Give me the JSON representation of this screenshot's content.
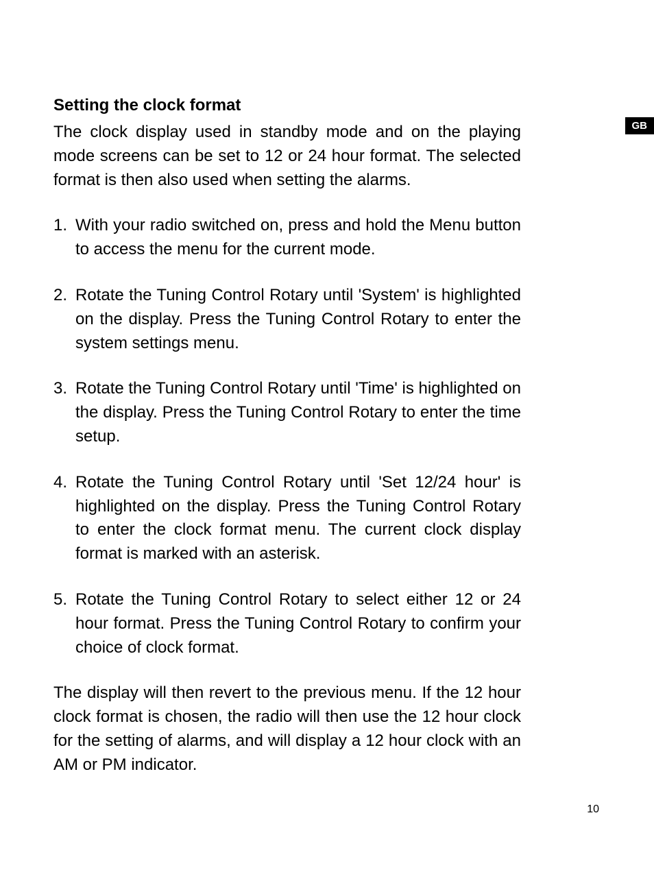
{
  "badge": "GB",
  "pageNumber": "10",
  "sectionTitle": "Setting the clock format",
  "introText": "The clock display used in standby mode and on the playing mode screens can be set to 12 or 24 hour format. The selected format is then also used when setting the alarms.",
  "steps": [
    {
      "number": "1.",
      "text": "With your radio switched on, press and hold the Menu button to access the menu for the current mode."
    },
    {
      "number": "2.",
      "text": "Rotate the Tuning Control Rotary until 'System' is highlighted on the display. Press the Tuning Control Rotary to enter the system settings menu."
    },
    {
      "number": "3.",
      "text": "Rotate the Tuning Control Rotary until 'Time' is highlighted on the display. Press the Tuning Control Rotary to enter the time setup."
    },
    {
      "number": "4.",
      "text": "Rotate the Tuning Control Rotary until 'Set 12/24 hour' is highlighted on the display. Press the Tuning Control Rotary to enter the clock format menu. The current clock display format is marked with an asterisk."
    },
    {
      "number": "5.",
      "text": "Rotate the Tuning Control Rotary to select either 12 or 24 hour format. Press the Tuning Control Rotary to confirm your choice of clock format."
    }
  ],
  "closingText": "The display will then revert to the previous menu. If the 12 hour clock format is chosen, the radio will then use the 12 hour clock for the setting of alarms, and will display a 12 hour clock with an AM or PM indicator."
}
